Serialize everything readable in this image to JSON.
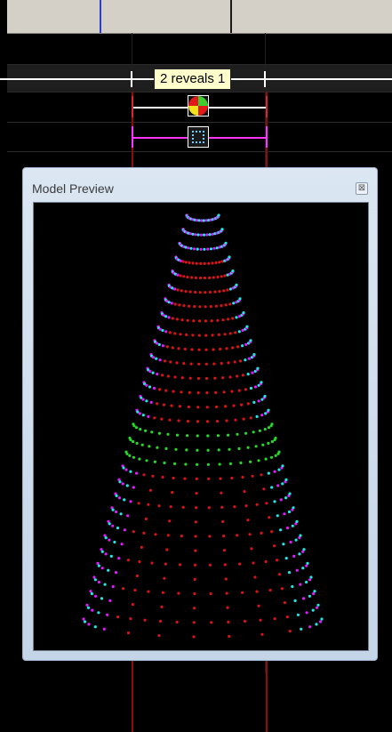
{
  "tooltip": {
    "text": "2 reveals 1"
  },
  "preview": {
    "title": "Model Preview",
    "close_label": "⊠"
  },
  "colors": {
    "ruler_bg": "#d4d0c8",
    "ruler_blue_tick": "#2b3dcf",
    "ruler_dark_tick": "#1a1a1a",
    "time_marker": "#8b0d0d",
    "effect_white": "#ffffff",
    "effect_magenta": "#ff33ff",
    "cone_magenta": "#e21bff",
    "cone_cyan": "#22e6e6",
    "cone_red": "#d81414",
    "cone_green": "#28d728"
  },
  "icons": {
    "effect_1": "color-wash-effect-icon",
    "effect_2": "dashed-square-effect-icon"
  }
}
